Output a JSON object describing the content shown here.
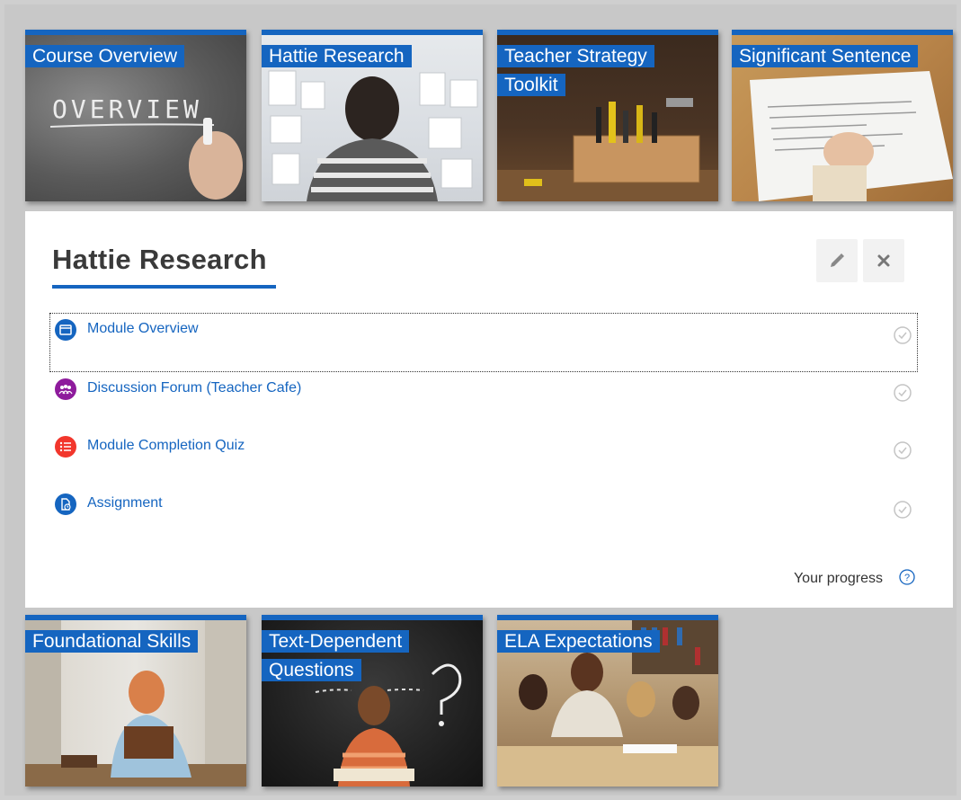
{
  "tiles_top": [
    {
      "label": "Course Overview"
    },
    {
      "label": "Hattie Research"
    },
    {
      "label": "Teacher Strategy Toolkit"
    },
    {
      "label": "Significant Sentence"
    }
  ],
  "image_text": {
    "overview": "OVERVIEW"
  },
  "panel": {
    "title": "Hattie Research",
    "edit_icon": "pencil-icon",
    "close_icon": "close-icon",
    "activities": [
      {
        "label": "Module Overview",
        "icon": "page-icon",
        "icon_color": "#1565c0"
      },
      {
        "label": "Discussion Forum (Teacher Cafe)",
        "icon": "forum-icon",
        "icon_color": "#8e1b9c"
      },
      {
        "label": "Module Completion Quiz",
        "icon": "quiz-icon",
        "icon_color": "#f2362c"
      },
      {
        "label": "Assignment",
        "icon": "assignment-icon",
        "icon_color": "#1565c0"
      }
    ],
    "progress_label": "Your progress"
  },
  "tiles_bottom": [
    {
      "label": "Foundational Skills"
    },
    {
      "label": "Text-Dependent Questions"
    },
    {
      "label": "ELA Expectations"
    }
  ],
  "colors": {
    "accent": "#1565c0",
    "background": "#c8c8c8"
  }
}
